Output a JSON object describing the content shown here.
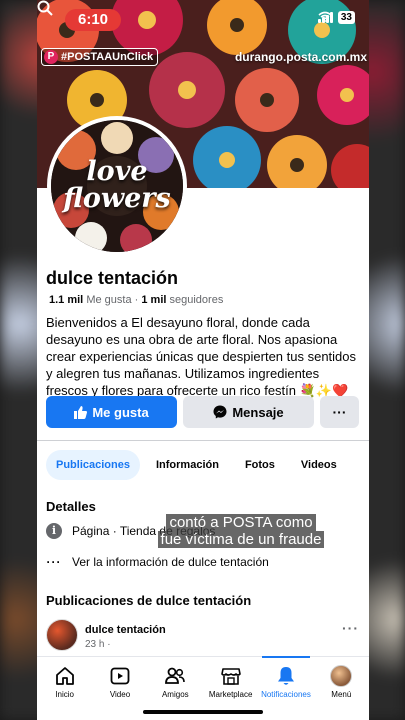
{
  "status_bar": {
    "time": "6:10",
    "battery": "33"
  },
  "overlay": {
    "tag": "#POSTAAUnClick",
    "tag_logo": "P",
    "url": "durango.posta.com.mx"
  },
  "profile": {
    "avatar_text_line1": "love",
    "avatar_text_line2": "flowers",
    "name": "dulce tentación",
    "likes_count": "1.1 mil",
    "likes_label": "Me gusta",
    "stats_separator": "·",
    "followers_count": "1 mil",
    "followers_label": "seguidores",
    "bio": "Bienvenidos a El desayuno floral, donde cada desayuno es una obra de arte floral. Nos apasiona crear experiencias únicas que despierten tus sentidos y alegren tus mañanas. Utilizamos ingredientes frescos y flores para ofrecerte un rico festín 💐✨❤️"
  },
  "actions": {
    "like": "Me gusta",
    "message": "Mensaje",
    "more": "···"
  },
  "tabs": [
    {
      "label": "Publicaciones",
      "active": true
    },
    {
      "label": "Información",
      "active": false
    },
    {
      "label": "Fotos",
      "active": false
    },
    {
      "label": "Videos",
      "active": false
    }
  ],
  "details": {
    "title": "Detalles",
    "page_type": "Página · Tienda de regalos",
    "more_info": "Ver la información de dulce tentación"
  },
  "caption": {
    "line1": "contó a POSTA como",
    "line2": "fue víctima de un fraude"
  },
  "posts": {
    "title": "Publicaciones de dulce tentación",
    "author": "dulce tentación",
    "time": "23 h ·",
    "more": "···"
  },
  "bottom_nav": [
    {
      "label": "Inicio",
      "icon": "home-icon"
    },
    {
      "label": "Video",
      "icon": "video-icon"
    },
    {
      "label": "Amigos",
      "icon": "friends-icon"
    },
    {
      "label": "Marketplace",
      "icon": "marketplace-icon"
    },
    {
      "label": "Notificaciones",
      "icon": "bell-icon",
      "active": true
    },
    {
      "label": "Menú",
      "icon": "menu-avatar"
    }
  ],
  "colors": {
    "brand_blue": "#1877f2",
    "button_gray": "#e4e6eb",
    "status_red": "#e53935"
  }
}
